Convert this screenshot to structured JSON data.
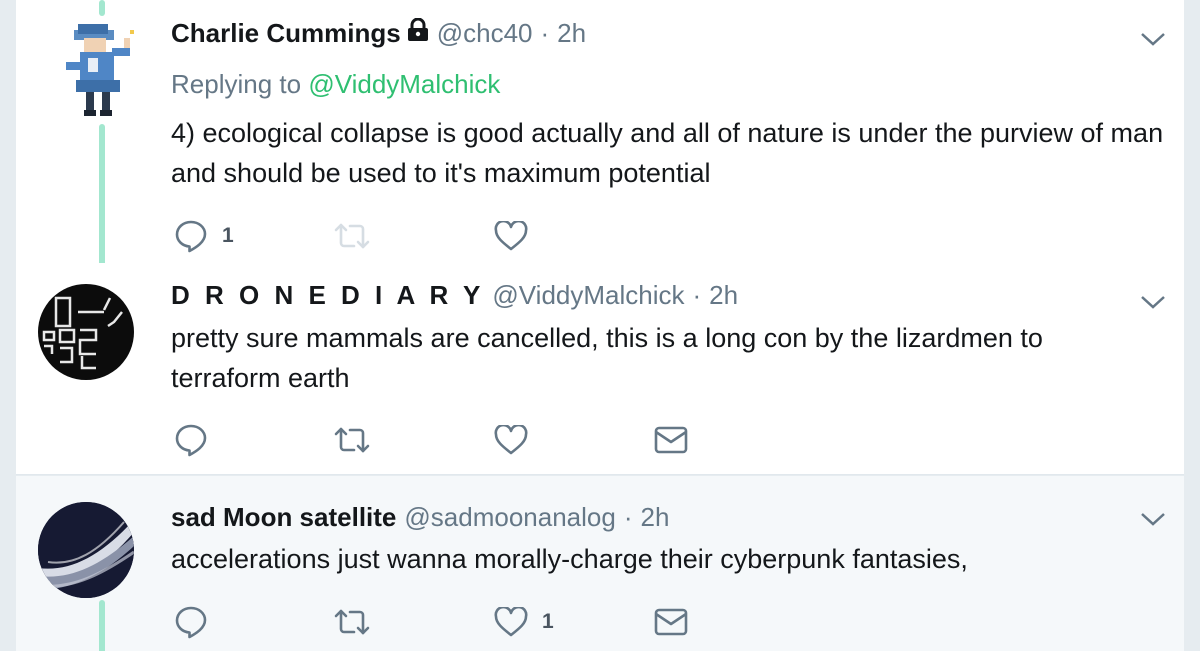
{
  "tweets": [
    {
      "name": "Charlie Cummings",
      "protected": true,
      "handle": "@chc40",
      "separator": "·",
      "time": "2h",
      "replying_label": "Replying to",
      "replying_to": "@ViddyMalchick",
      "text": "4) ecological collapse is good actually and all of nature is under the purview of man and should be used to it's maximum potential",
      "reply_count": "1"
    },
    {
      "name": "D R O N E D I A R Y",
      "handle": "@ViddyMalchick",
      "separator": "·",
      "time": "2h",
      "text": "pretty sure mammals are cancelled, this is a long con by the lizardmen to terraform earth"
    },
    {
      "name": "sad Moon satellite",
      "handle": "@sadmoonanalog",
      "separator": "·",
      "time": "2h",
      "text": "accelerations just wanna morally-charge their cyberpunk fantasies,",
      "like_count": "1"
    }
  ],
  "colors": {
    "thread_line": "#a3e7cf",
    "reply_link": "#2fbf71",
    "icon_gray": "#657786",
    "text": "#14171a"
  },
  "icons": [
    "lock-icon",
    "chevron-down-icon",
    "reply-icon",
    "retweet-icon",
    "like-icon",
    "direct-message-icon"
  ]
}
